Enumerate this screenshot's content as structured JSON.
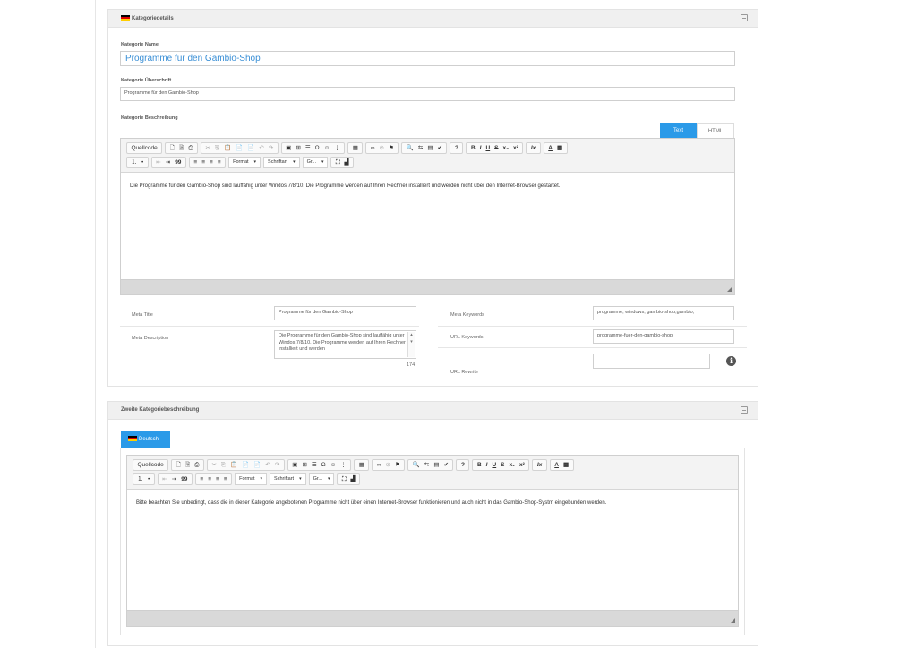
{
  "panel1": {
    "title": "Kategoriedetails",
    "category_name_label": "Kategorie Name",
    "category_name_value": "Programme für den Gambio-Shop",
    "category_heading_label": "Kategorie Überschrift",
    "category_heading_value": "Programme für den Gambio-Shop",
    "category_description_label": "Kategorie Beschreibung",
    "tab_text": "Text",
    "tab_html": "HTML",
    "editor_content": "Die Programme für den Gambio-Shop sind lauffähig unter Windos 7/8/10. Die Programme werden auf Ihren Rechner installiert und werden nicht über den Internet-Browser gestartet.",
    "meta_title_label": "Meta Title",
    "meta_title_value": "Programme für den Gambio-Shop",
    "meta_description_label": "Meta Description",
    "meta_description_value": "Die Programme für den Gambio-Shop sind lauffähig unter Windos 7/8/10. Die Programme werden auf Ihren Rechner installiert und werden",
    "meta_description_count": "174",
    "meta_keywords_label": "Meta Keywords",
    "meta_keywords_value": "programme, windows, gambio-shop,gambio,",
    "url_keywords_label": "URL Keywords",
    "url_keywords_value": "programme-fuer-den-gambio-shop",
    "url_rewrite_label": "URL Rewrite",
    "url_rewrite_value": "",
    "info_glyph": "i"
  },
  "panel2": {
    "title": "Zweite Kategoriebeschreibung",
    "language_tab": "Deutsch",
    "editor_content": "Bitte beachten Sie unbedingt, dass die in dieser Kategorie angebotenen Programme nicht über einen Internet-Browser funktionieren und auch nicht in das Gambio-Shop-Systm eingebunden werden."
  },
  "toolbar": {
    "source_label": "Quellcode",
    "format_label": "Format",
    "font_label": "Schriftart",
    "size_label": "Gr...",
    "icons": {
      "new_page": "🗋",
      "preview": "🗟",
      "print": "⎙",
      "cut": "✂",
      "copy": "⎘",
      "paste": "📋",
      "paste_text": "📄",
      "paste_word": "📄",
      "undo": "↶",
      "redo": "↷",
      "image": "▣",
      "table": "⊞",
      "hr": "☰",
      "special_char": "Ω",
      "smiley": "☺",
      "pagebreak": "⋮",
      "iframe": "▦",
      "link": "∞",
      "unlink": "⊘",
      "anchor": "⚑",
      "find": "🔍",
      "replace": "⇆",
      "select_all": "▤",
      "spellcheck": "✔",
      "help": "?",
      "bold": "B",
      "italic": "I",
      "underline": "U",
      "strike": "S",
      "subscript": "x₂",
      "superscript": "x²",
      "remove_format": "Ix",
      "text_color": "A",
      "bg_color": "▩",
      "ol": "⒈",
      "ul": "•",
      "outdent": "⇤",
      "indent": "⇥",
      "blockquote": "99",
      "align_left": "≡",
      "align_center": "≡",
      "align_right": "≡",
      "justify": "≡",
      "maximize": "⛶",
      "blocks": "▟"
    }
  }
}
